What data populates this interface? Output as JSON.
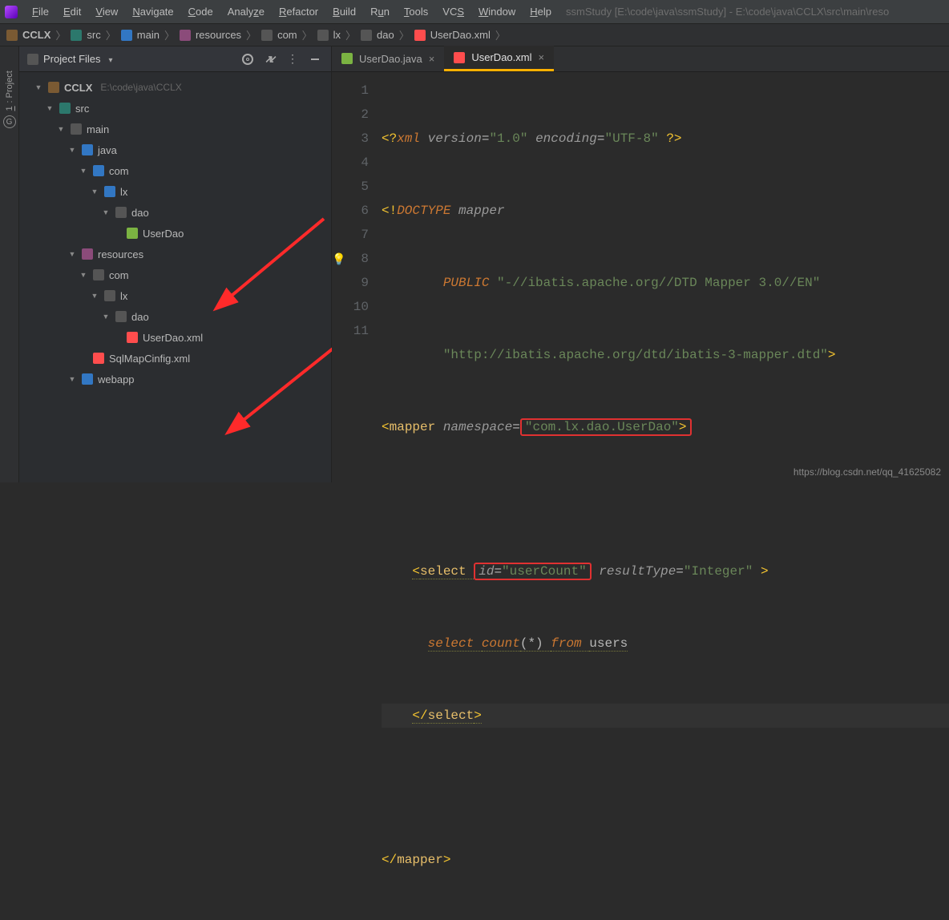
{
  "menu": {
    "items": [
      "File",
      "Edit",
      "View",
      "Navigate",
      "Code",
      "Analyze",
      "Refactor",
      "Build",
      "Run",
      "Tools",
      "VCS",
      "Window",
      "Help"
    ],
    "title": "ssmStudy [E:\\code\\java\\ssmStudy] - E:\\code\\java\\CCLX\\src\\main\\reso"
  },
  "breadcrumbs": [
    "CCLX",
    "src",
    "main",
    "resources",
    "com",
    "lx",
    "dao",
    "UserDao.xml"
  ],
  "project_panel": {
    "title": "Project Files"
  },
  "tree": {
    "root": {
      "name": "CCLX",
      "path": "E:\\code\\java\\CCLX"
    },
    "nodes": [
      {
        "name": "src"
      },
      {
        "name": "main"
      },
      {
        "name": "java"
      },
      {
        "name": "com"
      },
      {
        "name": "lx"
      },
      {
        "name": "dao"
      },
      {
        "name": "UserDao"
      },
      {
        "name": "resources"
      },
      {
        "name": "com"
      },
      {
        "name": "lx"
      },
      {
        "name": "dao"
      },
      {
        "name": "UserDao.xml"
      },
      {
        "name": "SqlMapCinfig.xml"
      },
      {
        "name": "webapp"
      }
    ]
  },
  "tabs": [
    {
      "label": "UserDao.java"
    },
    {
      "label": "UserDao.xml"
    }
  ],
  "code": {
    "xml_decl_version": "\"1.0\"",
    "xml_decl_encoding": "\"UTF-8\"",
    "doctype": "mapper",
    "public1": "\"-//ibatis.apache.org//DTD Mapper 3.0//EN\"",
    "public2": "\"http://ibatis.apache.org/dtd/ibatis-3-mapper.dtd\"",
    "namespace": "\"com.lx.dao.UserDao\"",
    "select_id": "\"userCount\"",
    "select_rt": "\"Integer\"",
    "sql": "select count(*) from users"
  },
  "line_numbers": [
    "1",
    "2",
    "3",
    "4",
    "5",
    "6",
    "7",
    "8",
    "9",
    "10",
    "11"
  ],
  "watermark": "https://blog.csdn.net/qq_41625082"
}
